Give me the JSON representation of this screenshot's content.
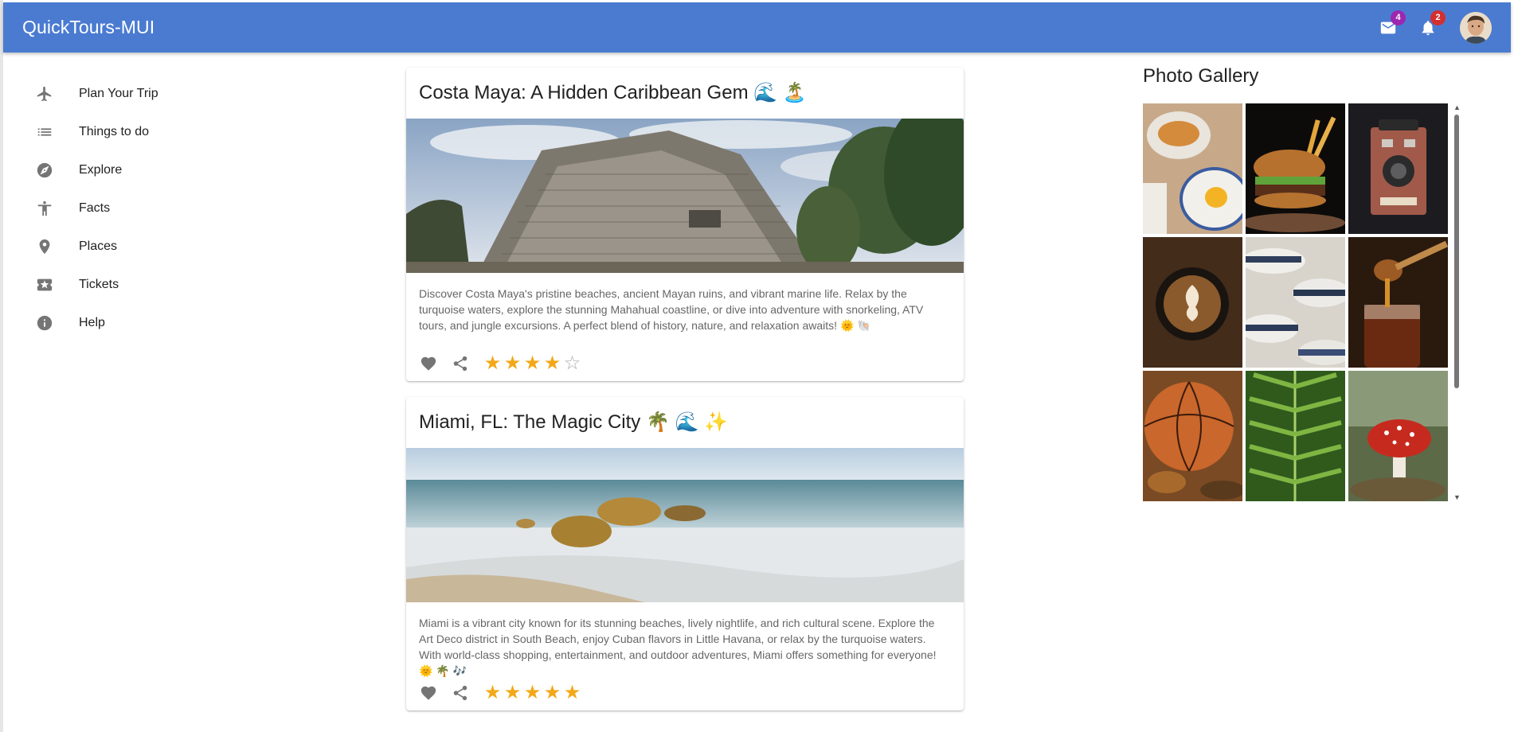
{
  "app": {
    "title": "QuickTours-MUI"
  },
  "header": {
    "mail_badge": "4",
    "notifications_badge": "2"
  },
  "sidebar": {
    "items": [
      {
        "label": "Plan Your Trip",
        "icon": "airplane-icon"
      },
      {
        "label": "Things to do",
        "icon": "list-icon"
      },
      {
        "label": "Explore",
        "icon": "compass-icon"
      },
      {
        "label": "Facts",
        "icon": "accessibility-icon"
      },
      {
        "label": "Places",
        "icon": "location-pin-icon"
      },
      {
        "label": "Tickets",
        "icon": "ticket-icon"
      },
      {
        "label": "Help",
        "icon": "info-icon"
      }
    ]
  },
  "cards": [
    {
      "title": "Costa Maya: A Hidden Caribbean Gem 🌊 🏝️",
      "description": "Discover Costa Maya's pristine beaches, ancient Mayan ruins, and vibrant marine life. Relax by the turquoise waters, explore the stunning Mahahual coastline, or dive into adventure with snorkeling, ATV tours, and jungle excursions. A perfect blend of history, nature, and relaxation awaits! 🌞 🐚",
      "rating": 4,
      "image": "mayan-pyramid-ruins-photo"
    },
    {
      "title": "Miami, FL: The Magic City 🌴 🌊 ✨",
      "description": "Miami is a vibrant city known for its stunning beaches, lively nightlife, and rich cultural scene. Explore the Art Deco district in South Beach, enjoy Cuban flavors in Little Havana, or relax by the turquoise waters. With world-class shopping, entertainment, and outdoor adventures, Miami offers something for everyone! 🌞 🌴 🎶",
      "rating": 5,
      "image": "beach-rocks-seascape-photo"
    }
  ],
  "gallery": {
    "title": "Photo Gallery",
    "photos": [
      "breakfast",
      "burger-and-fries",
      "vintage-camera",
      "latte-art",
      "hats",
      "honey-jar",
      "basketball",
      "fern",
      "mushroom"
    ]
  },
  "colors": {
    "appbar": "#4a7bd1",
    "star": "#f2a818",
    "mail_badge": "#9c27b0",
    "notification_badge": "#d32f2f"
  }
}
